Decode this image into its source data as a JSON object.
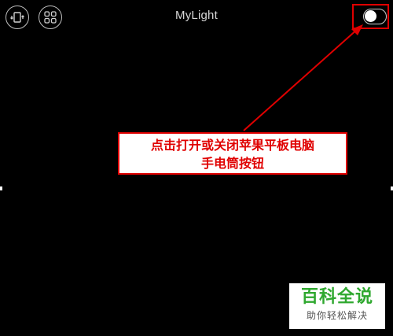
{
  "header": {
    "title": "MyLight",
    "icons": {
      "rotate": "rotate-screen-icon",
      "grid": "grid-apps-icon"
    }
  },
  "toggle": {
    "state": "off"
  },
  "callout": {
    "line1": "点击打开或关闭苹果平板电脑",
    "line2": "手电筒按钮"
  },
  "watermark": {
    "main": "百科全说",
    "sub": "助你轻松解决"
  },
  "colors": {
    "background": "#000000",
    "annotation_red": "#e00000",
    "watermark_green": "#2fa82f"
  }
}
